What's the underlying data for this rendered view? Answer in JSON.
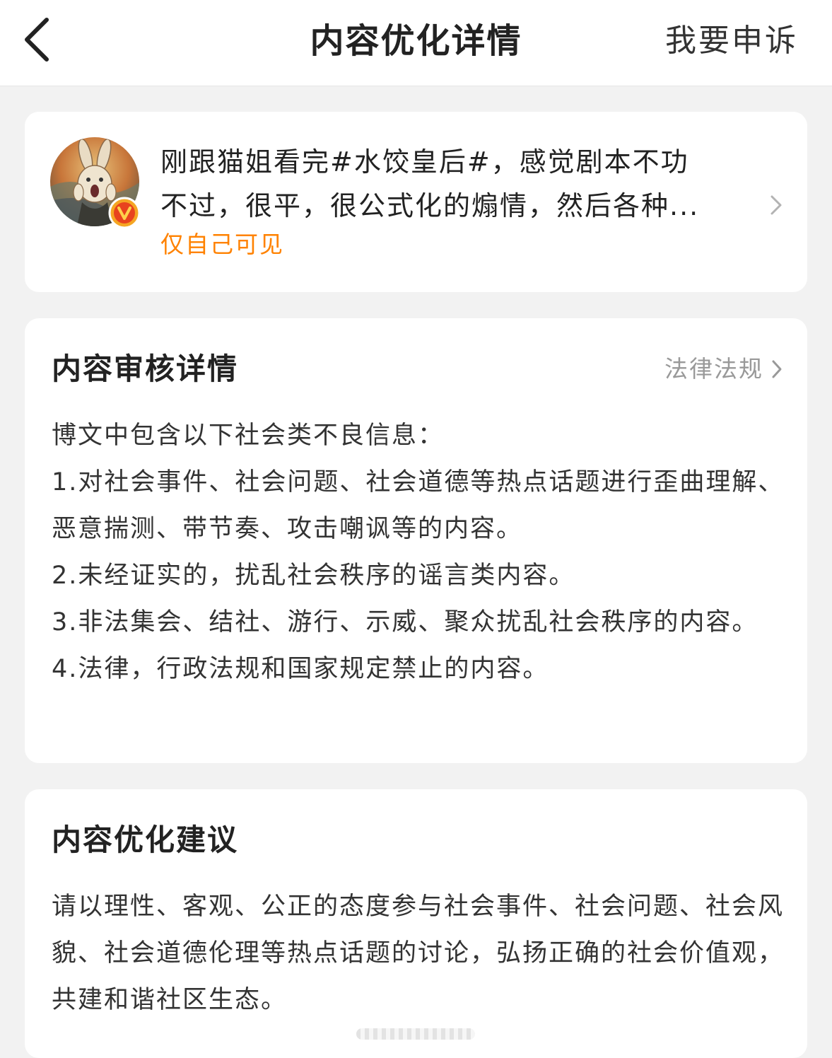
{
  "navbar": {
    "title": "内容优化详情",
    "appeal_label": "我要申诉"
  },
  "post": {
    "text_line1": "刚跟猫姐看完#水饺皇后#，感觉剧本不功",
    "text_line2": "不过，很平，很公式化的煽情，然后各种...",
    "visibility": "仅自己可见"
  },
  "review": {
    "title": "内容审核详情",
    "law_link": "法律法规",
    "intro": "博文中包含以下社会类不良信息：",
    "items": [
      "1.对社会事件、社会问题、社会道德等热点话题进行歪曲理解、恶意揣测、带节奏、攻击嘲讽等的内容。",
      "2.未经证实的，扰乱社会秩序的谣言类内容。",
      "3.非法集会、结社、游行、示威、聚众扰乱社会秩序的内容。",
      "4.法律，行政法规和国家规定禁止的内容。"
    ]
  },
  "suggestion": {
    "title": "内容优化建议",
    "text": "请以理性、客观、公正的态度参与社会事件、社会问题、社会风貌、社会道德伦理等热点话题的讨论，弘扬正确的社会价值观，共建和谐社区生态。"
  },
  "icons": {
    "back": "back-arrow-icon",
    "verified": "verified-v-icon",
    "chevron": "chevron-right-icon"
  },
  "colors": {
    "accent_orange": "#ff8200",
    "verified_badge": "#f5a623"
  }
}
